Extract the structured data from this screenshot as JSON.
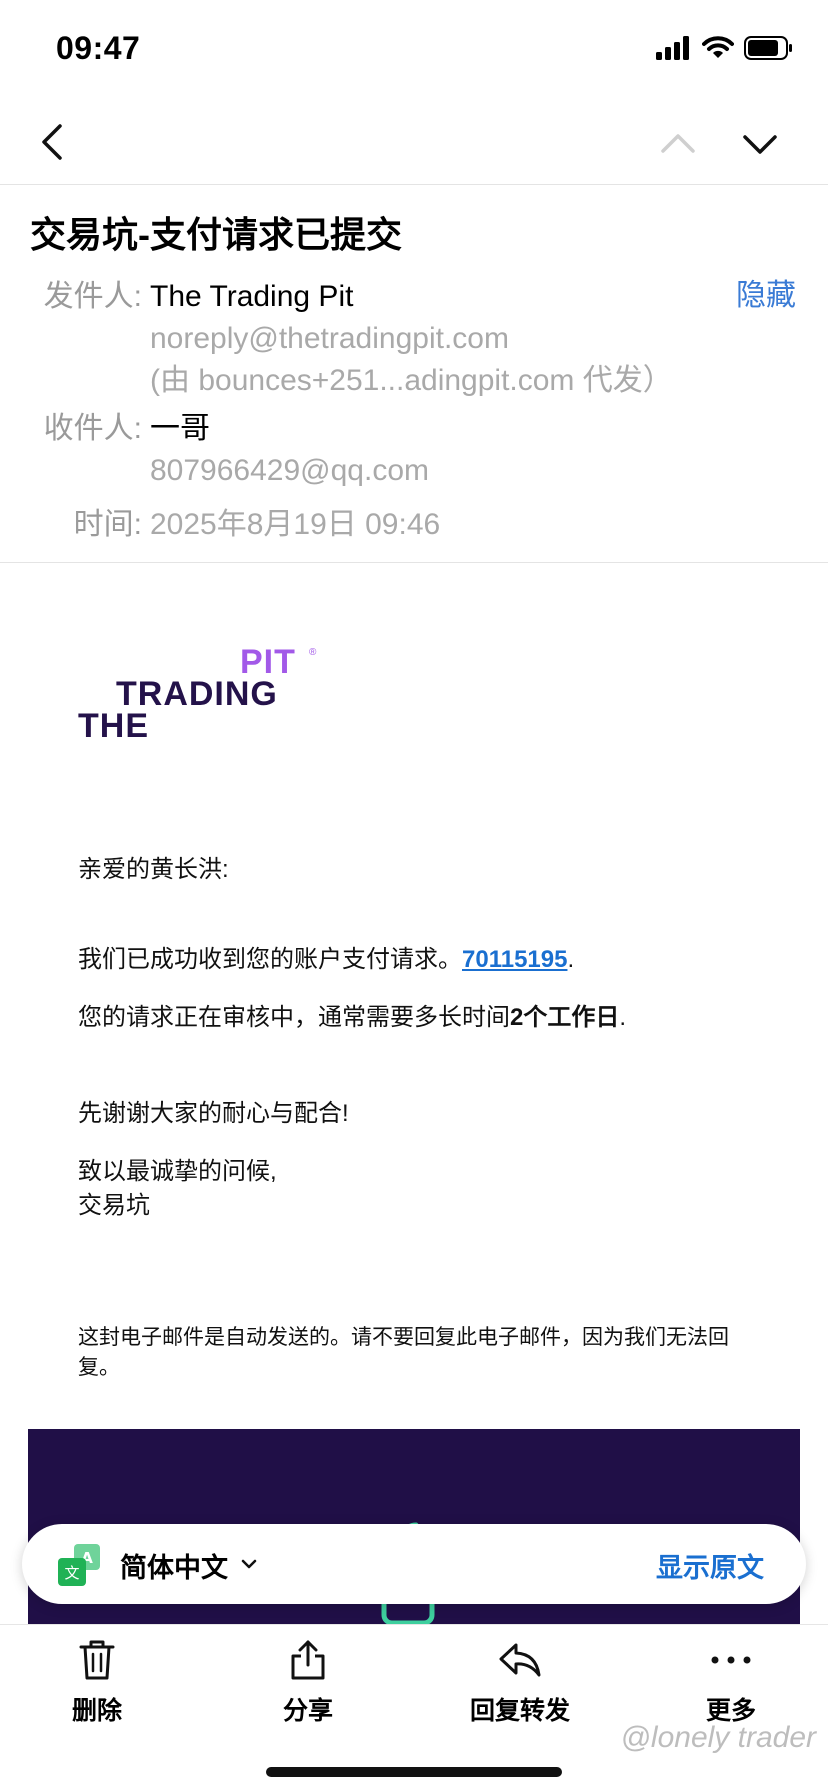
{
  "status_bar": {
    "time": "09:47"
  },
  "mail": {
    "subject": "交易坑-支付请求已提交",
    "hide_label": "隐藏",
    "from_label": "发件人:",
    "from_name": "The Trading Pit",
    "from_email": "noreply@thetradingpit.com",
    "from_via": "(由 bounces+251...adingpit.com 代发）",
    "to_label": "收件人:",
    "to_name": "一哥",
    "to_email": "807966429@qq.com",
    "time_label": "时间:",
    "time_value": "2025年8月19日 09:46"
  },
  "body": {
    "logo": {
      "pit": "PIT",
      "trading": "TRADING",
      "the": "THE"
    },
    "greeting": "亲爱的黄长洪:",
    "line1_prefix": "我们已成功收到您的账户支付请求。",
    "line1_link": "70115195",
    "line1_suffix": ".",
    "line2_prefix": "您的请求正在审核中，通常需要多长时间",
    "line2_bold": "2个工作日",
    "line2_suffix": ".",
    "thanks": "先谢谢大家的耐心与配合!",
    "regards": "致以最诚挚的问候,",
    "signature": "交易坑",
    "auto_notice": "这封电子邮件是自动发送的。请不要回复此电子邮件，因为我们无法回复。"
  },
  "translate_bar": {
    "language": "简体中文",
    "show_original": "显示原文"
  },
  "toolbar": {
    "delete": "删除",
    "share": "分享",
    "reply_forward": "回复转发",
    "more": "更多"
  },
  "watermark": "@lonely trader",
  "colors": {
    "accent_blue": "#1a6fd0",
    "logo_purple": "#a259e8",
    "logo_dark": "#24124a",
    "banner_bg": "#200f47"
  }
}
